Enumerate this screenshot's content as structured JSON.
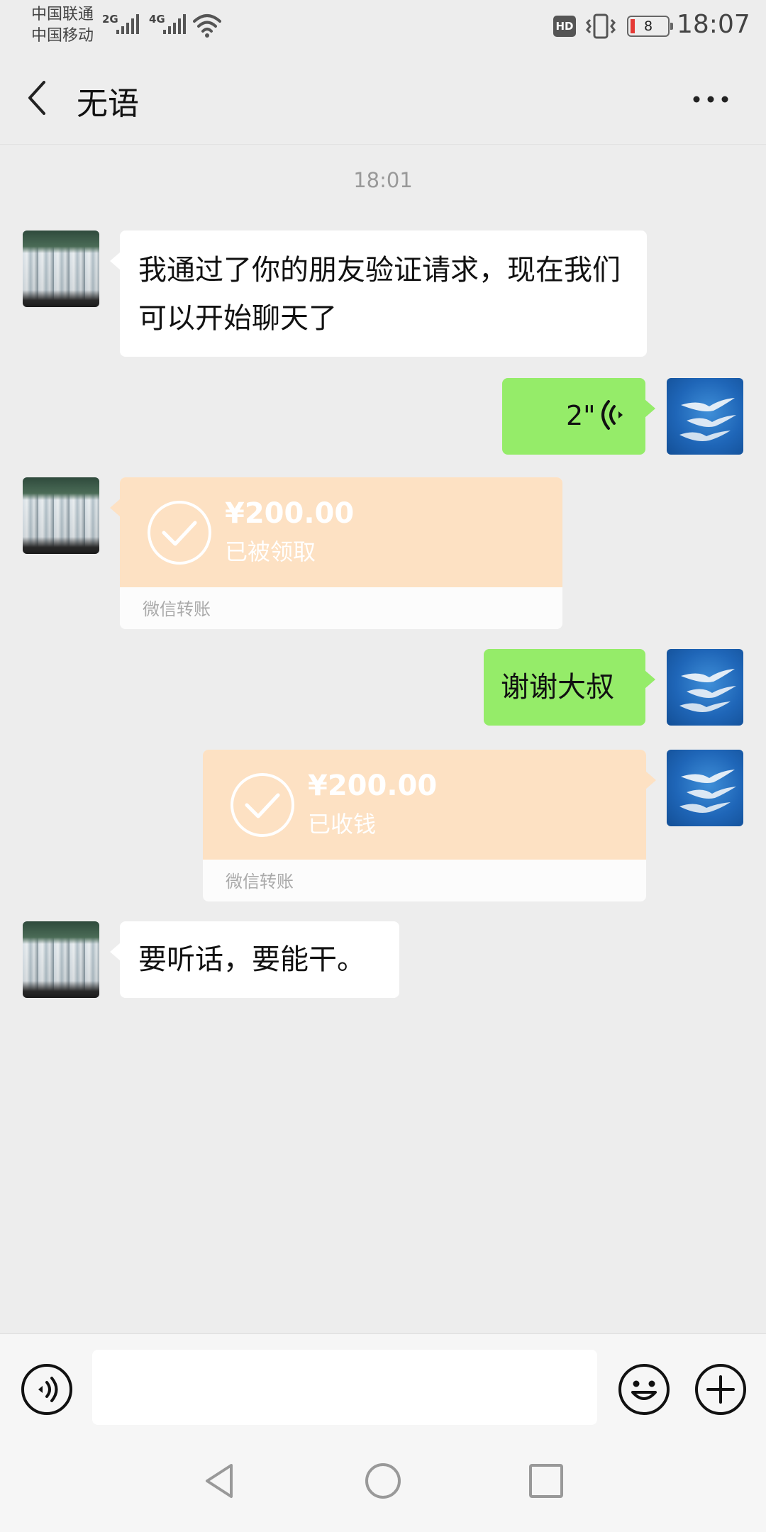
{
  "status_bar": {
    "carrier_1": "中国联通",
    "carrier_2": "中国移动",
    "network_1": "2G",
    "network_2": "4G",
    "hd_label": "HD",
    "battery_level": "8",
    "battery_fraction": 0.08,
    "time": "18:07",
    "icons": [
      "signal-icon",
      "wifi-icon",
      "vibrate-icon",
      "battery-icon"
    ]
  },
  "header": {
    "title": "无语",
    "back_icon": "chevron-left-icon",
    "more_icon": "more-dots-icon"
  },
  "chat": {
    "time_divider": "18:01",
    "messages": [
      {
        "side": "left",
        "type": "text",
        "text": "我通过了你的朋友验证请求，现在我们可以开始聊天了"
      },
      {
        "side": "right",
        "type": "voice",
        "duration": "2\""
      },
      {
        "side": "left",
        "type": "transfer",
        "amount": "¥200.00",
        "status": "已被领取",
        "source": "微信转账"
      },
      {
        "side": "right",
        "type": "text",
        "text": "谢谢大叔"
      },
      {
        "side": "right",
        "type": "transfer",
        "amount": "¥200.00",
        "status": "已收钱",
        "source": "微信转账"
      },
      {
        "side": "left",
        "type": "text",
        "text": "要听话，要能干。"
      }
    ]
  },
  "input_bar": {
    "voice_icon": "voice-input-icon",
    "input_value": "",
    "emoji_icon": "emoji-icon",
    "plus_icon": "plus-icon"
  },
  "colors": {
    "background": "#ededed",
    "bubble_self": "#95ec69",
    "bubble_other": "#ffffff",
    "transfer_card": "#fde1c3",
    "accent_text": "#111111"
  }
}
